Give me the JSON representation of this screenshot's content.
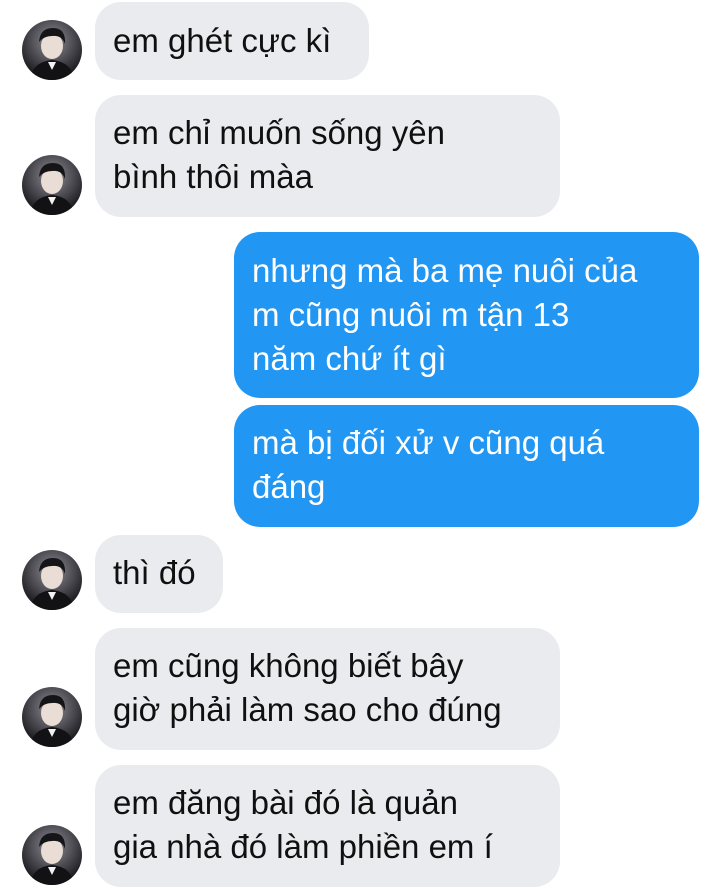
{
  "messages": [
    {
      "sender": "contact",
      "text": "em ghét cực kì"
    },
    {
      "sender": "contact",
      "text": "em chỉ muốn sống yên\nbình thôi màa"
    },
    {
      "sender": "me",
      "text": "nhưng mà ba mẹ nuôi của\nm cũng nuôi m tận 13\nnăm chứ ít gì"
    },
    {
      "sender": "me",
      "text": "mà bị đối xử v cũng quá\nđáng"
    },
    {
      "sender": "contact",
      "text": "thì đó"
    },
    {
      "sender": "contact",
      "text": "em cũng không biết bây\ngiờ phải làm sao cho đúng"
    },
    {
      "sender": "contact",
      "text": "em đăng bài đó là quản\ngia nhà đó làm phiền em í"
    }
  ],
  "avatar": {
    "icon": "contact-avatar-photo"
  },
  "colors": {
    "incoming_bubble": "#e9ebee",
    "outgoing_bubble": "#2196f3",
    "background": "#ffffff"
  }
}
